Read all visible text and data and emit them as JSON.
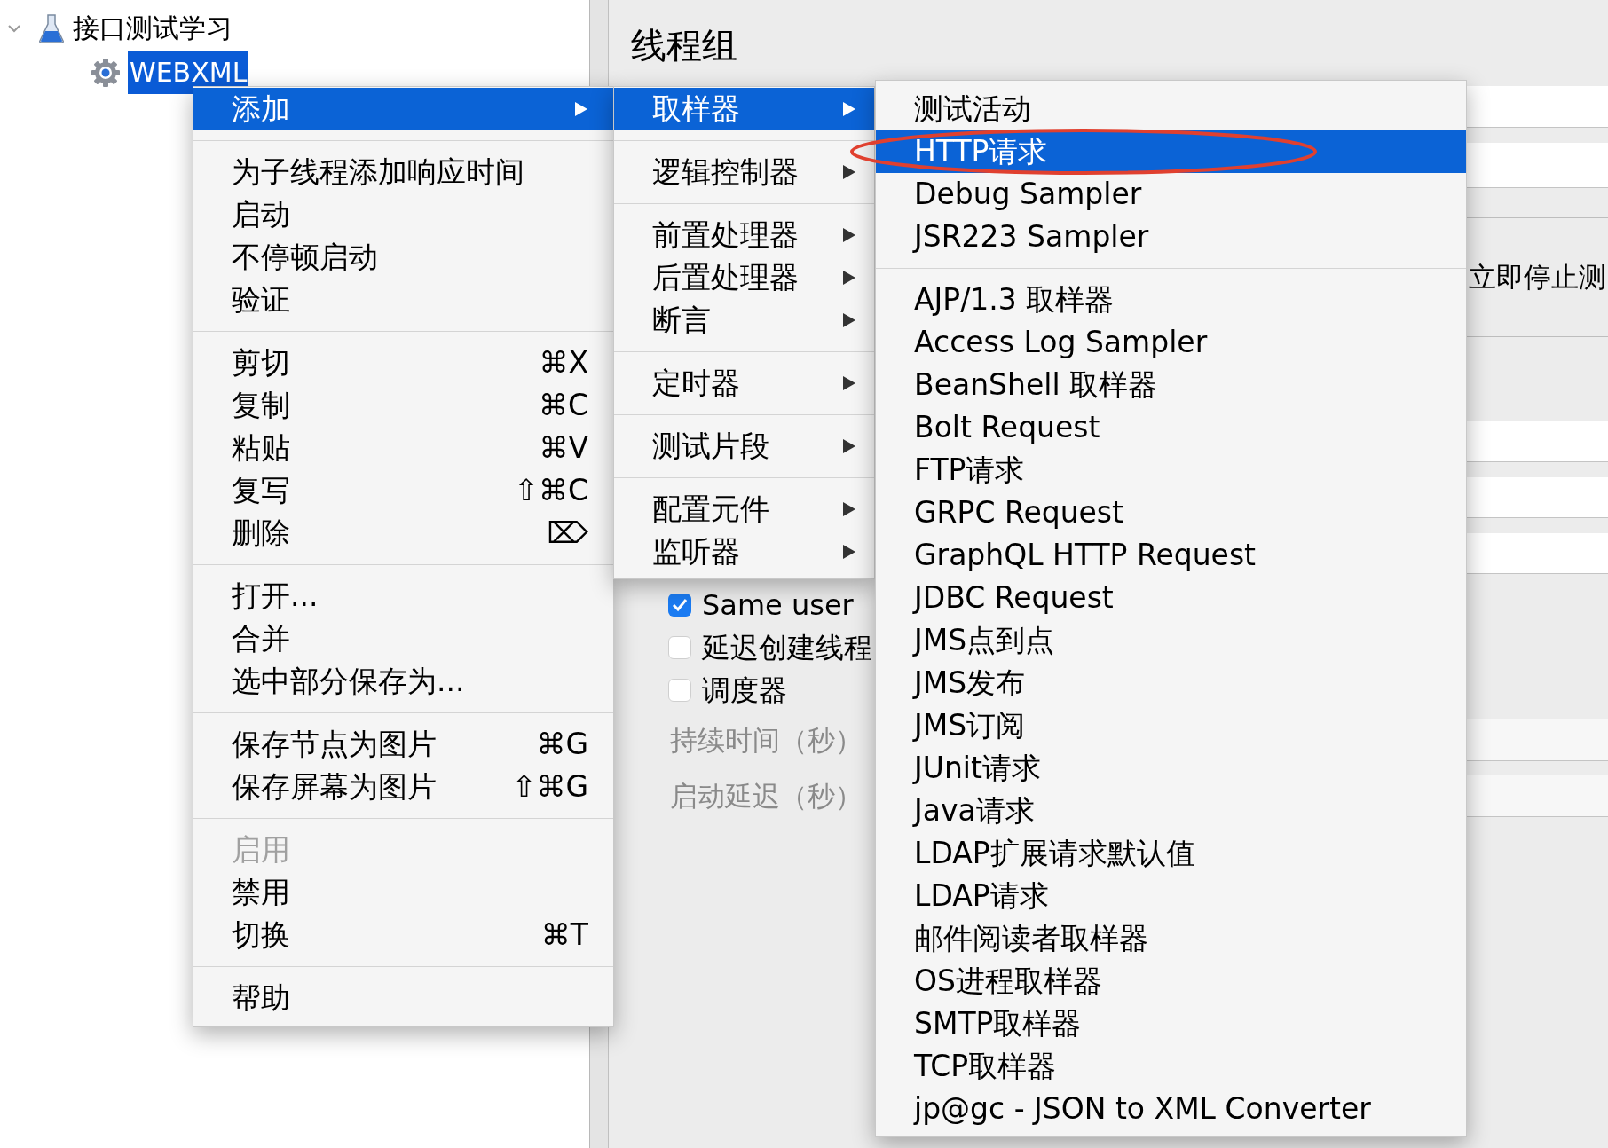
{
  "tree": [
    {
      "label": "接口测试学习",
      "kind": "test-plan",
      "expanded": true,
      "selected": false,
      "children": [
        {
          "label": "WEBXML",
          "kind": "thread-group",
          "selected": true
        }
      ]
    }
  ],
  "panel": {
    "title": "线程组",
    "stop_option": "立即停止测",
    "checkboxes": [
      {
        "label": "Same user",
        "checked": true
      },
      {
        "label": "延迟创建线程",
        "checked": false
      },
      {
        "label": "调度器",
        "checked": false
      }
    ],
    "timing_fields": [
      {
        "label": "持续时间（秒）",
        "disabled": true
      },
      {
        "label": "启动延迟（秒）",
        "disabled": true
      }
    ]
  },
  "context_menu": {
    "groups": [
      [
        {
          "label": "添加",
          "has_submenu": true,
          "selected": true,
          "disabled": false
        }
      ],
      [
        {
          "label": "为子线程添加响应时间",
          "has_submenu": false,
          "selected": false,
          "disabled": false
        },
        {
          "label": "启动",
          "has_submenu": false,
          "selected": false,
          "disabled": false
        },
        {
          "label": "不停顿启动",
          "has_submenu": false,
          "selected": false,
          "disabled": false
        },
        {
          "label": "验证",
          "has_submenu": false,
          "selected": false,
          "disabled": false
        }
      ],
      [
        {
          "label": "剪切",
          "shortcut": "⌘X",
          "has_submenu": false,
          "selected": false,
          "disabled": false
        },
        {
          "label": "复制",
          "shortcut": "⌘C",
          "has_submenu": false,
          "selected": false,
          "disabled": false
        },
        {
          "label": "粘贴",
          "shortcut": "⌘V",
          "has_submenu": false,
          "selected": false,
          "disabled": false
        },
        {
          "label": "复写",
          "shortcut": "⇧⌘C",
          "has_submenu": false,
          "selected": false,
          "disabled": false
        },
        {
          "label": "删除",
          "shortcut": "⌦",
          "has_submenu": false,
          "selected": false,
          "disabled": false
        }
      ],
      [
        {
          "label": "打开...",
          "has_submenu": false,
          "selected": false,
          "disabled": false
        },
        {
          "label": "合并",
          "has_submenu": false,
          "selected": false,
          "disabled": false
        },
        {
          "label": "选中部分保存为...",
          "has_submenu": false,
          "selected": false,
          "disabled": false
        }
      ],
      [
        {
          "label": "保存节点为图片",
          "shortcut": "⌘G",
          "has_submenu": false,
          "selected": false,
          "disabled": false
        },
        {
          "label": "保存屏幕为图片",
          "shortcut": "⇧⌘G",
          "has_submenu": false,
          "selected": false,
          "disabled": false
        }
      ],
      [
        {
          "label": "启用",
          "has_submenu": false,
          "selected": false,
          "disabled": true
        },
        {
          "label": "禁用",
          "has_submenu": false,
          "selected": false,
          "disabled": false
        },
        {
          "label": "切换",
          "shortcut": "⌘T",
          "has_submenu": false,
          "selected": false,
          "disabled": false
        }
      ],
      [
        {
          "label": "帮助",
          "has_submenu": false,
          "selected": false,
          "disabled": false
        }
      ]
    ]
  },
  "add_menu": {
    "groups": [
      [
        {
          "label": "取样器",
          "selected": true
        }
      ],
      [
        {
          "label": "逻辑控制器",
          "selected": false
        }
      ],
      [
        {
          "label": "前置处理器",
          "selected": false
        },
        {
          "label": "后置处理器",
          "selected": false
        },
        {
          "label": "断言",
          "selected": false
        }
      ],
      [
        {
          "label": "定时器",
          "selected": false
        }
      ],
      [
        {
          "label": "测试片段",
          "selected": false
        }
      ],
      [
        {
          "label": "配置元件",
          "selected": false
        },
        {
          "label": "监听器",
          "selected": false
        }
      ]
    ]
  },
  "sampler_menu": {
    "groups": [
      [
        {
          "label": "测试活动",
          "selected": false,
          "circled": false
        },
        {
          "label": "HTTP请求",
          "selected": true,
          "circled": true
        },
        {
          "label": "Debug Sampler",
          "selected": false,
          "circled": false
        },
        {
          "label": "JSR223 Sampler",
          "selected": false,
          "circled": false
        }
      ],
      [
        {
          "label": "AJP/1.3 取样器",
          "selected": false,
          "circled": false
        },
        {
          "label": "Access Log Sampler",
          "selected": false,
          "circled": false
        },
        {
          "label": "BeanShell 取样器",
          "selected": false,
          "circled": false
        },
        {
          "label": "Bolt Request",
          "selected": false,
          "circled": false
        },
        {
          "label": "FTP请求",
          "selected": false,
          "circled": false
        },
        {
          "label": "GRPC Request",
          "selected": false,
          "circled": false
        },
        {
          "label": "GraphQL HTTP Request",
          "selected": false,
          "circled": false
        },
        {
          "label": "JDBC Request",
          "selected": false,
          "circled": false
        },
        {
          "label": "JMS点到点",
          "selected": false,
          "circled": false
        },
        {
          "label": "JMS发布",
          "selected": false,
          "circled": false
        },
        {
          "label": "JMS订阅",
          "selected": false,
          "circled": false
        },
        {
          "label": "JUnit请求",
          "selected": false,
          "circled": false
        },
        {
          "label": "Java请求",
          "selected": false,
          "circled": false
        },
        {
          "label": "LDAP扩展请求默认值",
          "selected": false,
          "circled": false
        },
        {
          "label": "LDAP请求",
          "selected": false,
          "circled": false
        },
        {
          "label": "邮件阅读者取样器",
          "selected": false,
          "circled": false
        },
        {
          "label": "OS进程取样器",
          "selected": false,
          "circled": false
        },
        {
          "label": "SMTP取样器",
          "selected": false,
          "circled": false
        },
        {
          "label": "TCP取样器",
          "selected": false,
          "circled": false
        },
        {
          "label": "jp@gc - JSON to XML Converter",
          "selected": false,
          "circled": false
        }
      ]
    ]
  }
}
